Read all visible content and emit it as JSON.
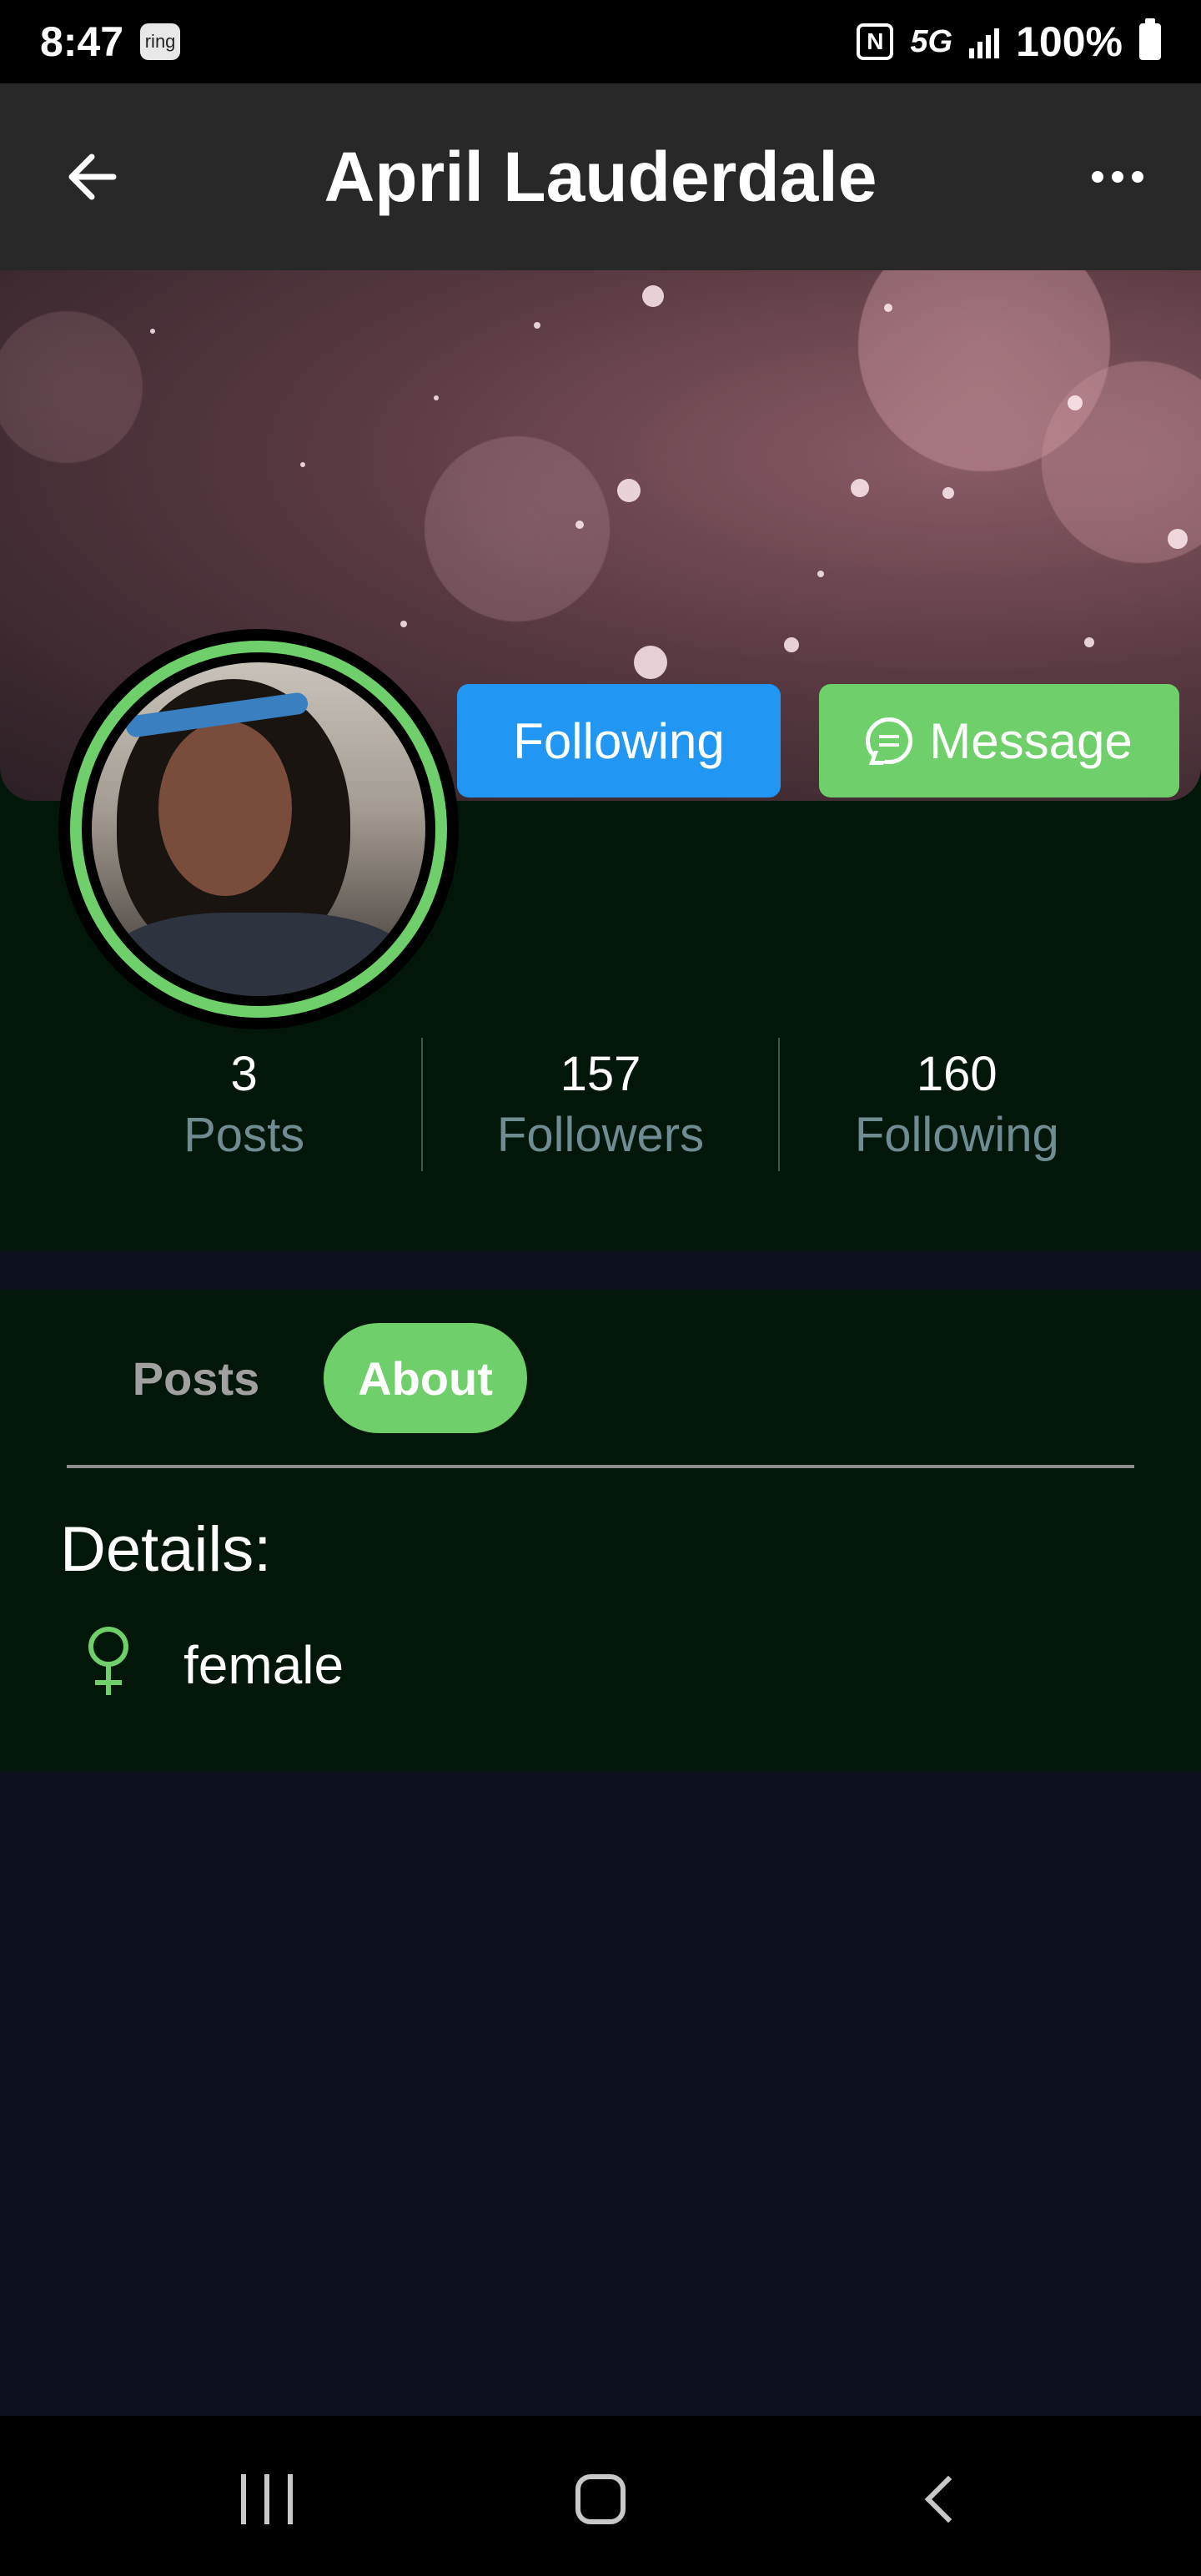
{
  "status_bar": {
    "time": "8:47",
    "ring_badge": "ring",
    "nfc_label": "N",
    "network": "5G",
    "battery": "100%"
  },
  "header": {
    "title": "April Lauderdale",
    "back_icon": "arrow-left-icon",
    "more_icon": "more-horizontal-icon"
  },
  "profile": {
    "follow_button_label": "Following",
    "message_button_label": "Message",
    "stats": [
      {
        "value": "3",
        "label": "Posts"
      },
      {
        "value": "157",
        "label": "Followers"
      },
      {
        "value": "160",
        "label": "Following"
      }
    ]
  },
  "tabs": [
    {
      "label": "Posts",
      "active": false
    },
    {
      "label": "About",
      "active": true
    }
  ],
  "about": {
    "heading": "Details:",
    "gender_icon": "female-symbol-icon",
    "gender": "female"
  },
  "colors": {
    "accent_green": "#6fcf6b",
    "follow_blue": "#2196f3",
    "section_bg": "#02170a",
    "page_bg": "#0b0f1e",
    "app_bar_bg": "#282828"
  }
}
